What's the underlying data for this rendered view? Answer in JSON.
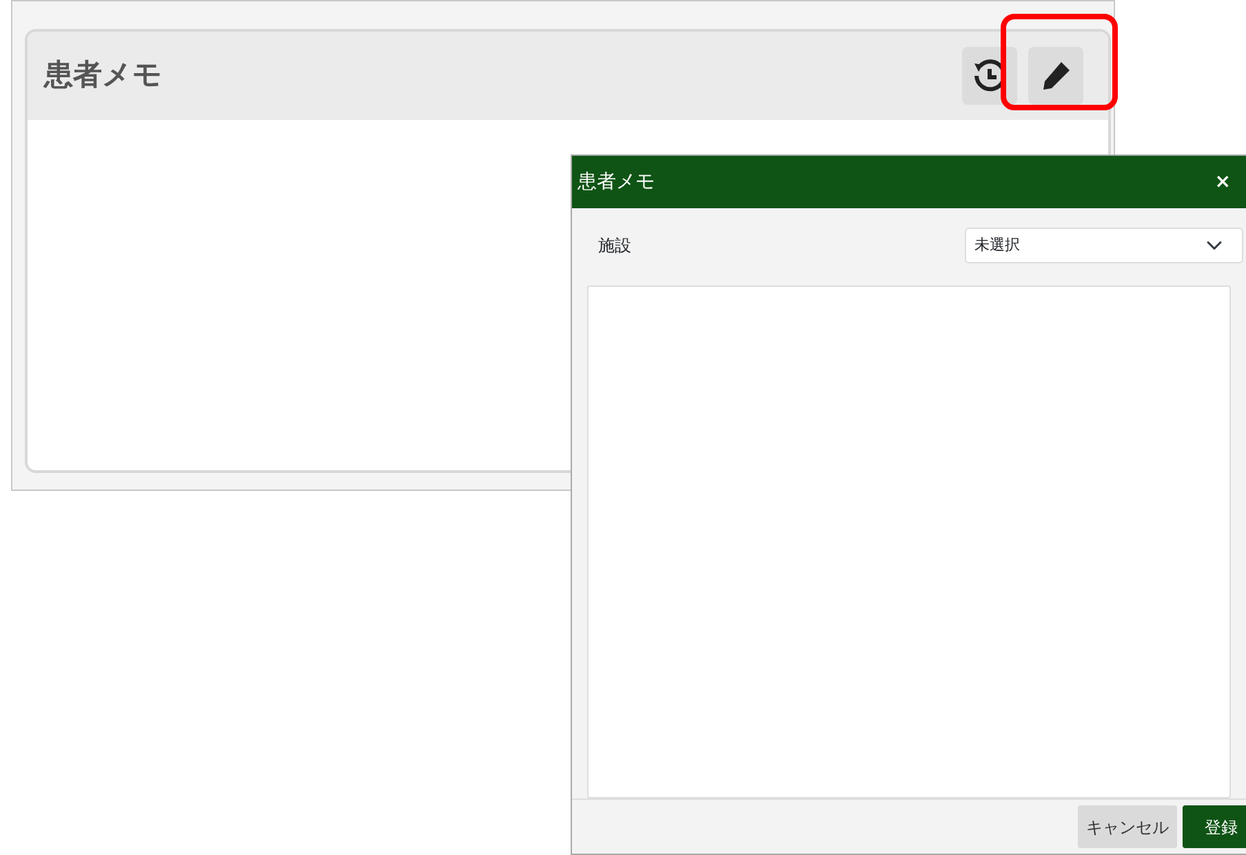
{
  "panel": {
    "title": "患者メモ",
    "edit_highlighted": true
  },
  "dialog": {
    "title": "患者メモ",
    "close": "×",
    "facility_label": "施設",
    "facility_value": "未選択",
    "buttons": [
      {
        "label": "キャンセル",
        "kind": "secondary"
      },
      {
        "label": "登録",
        "kind": "primary"
      }
    ]
  }
}
